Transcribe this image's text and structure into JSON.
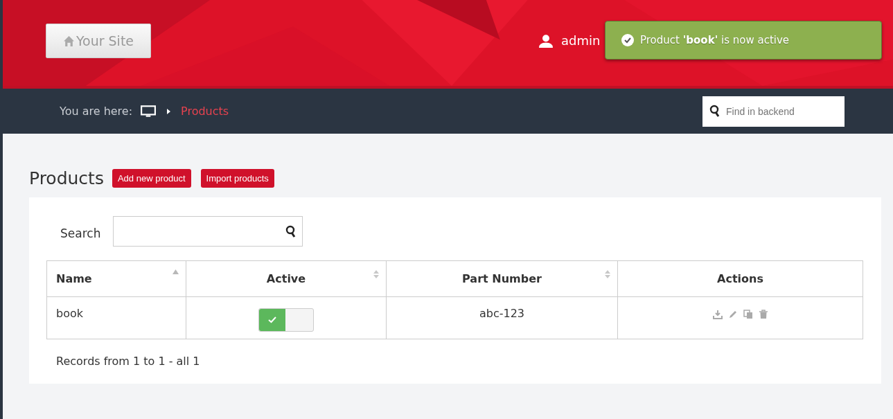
{
  "header": {
    "site_button": "Your Site",
    "user": "admin"
  },
  "toast": {
    "parts": [
      "Product ",
      "'book'",
      " is now active"
    ]
  },
  "breadcrumb": {
    "label": "You are here:",
    "current": "Products"
  },
  "backend_search": {
    "placeholder": "Find in backend"
  },
  "page": {
    "title": "Products",
    "buttons": [
      "Add new product",
      "Import products"
    ]
  },
  "search": {
    "label": "Search"
  },
  "table": {
    "columns": [
      {
        "label": "Name",
        "sortable": true,
        "sorted": true
      },
      {
        "label": "Active",
        "sortable": true,
        "sorted": false
      },
      {
        "label": "Part Number",
        "sortable": true,
        "sorted": false
      },
      {
        "label": "Actions",
        "sortable": false
      }
    ],
    "rows": [
      {
        "name": "book",
        "active": true,
        "part_number": "abc-123"
      }
    ]
  },
  "footer": "Records from 1 to 1 - all 1"
}
